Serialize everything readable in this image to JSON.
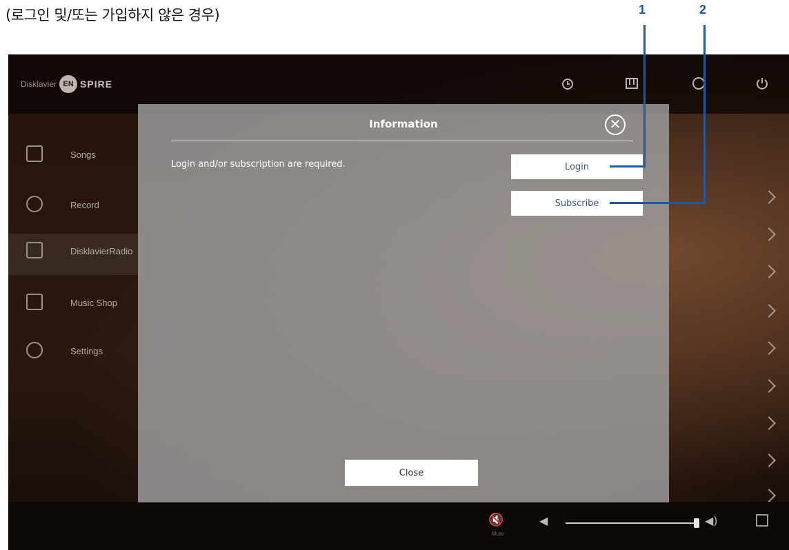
{
  "caption": "(로그인 및/또는 가입하지 않은 경우)",
  "callouts": [
    "1",
    "2"
  ],
  "app": {
    "logo": {
      "prefix": "Disklavier",
      "badge": "EN",
      "suffix": "SPIRE"
    },
    "top_icons": [
      "clock-icon",
      "piano-icon",
      "info-icon",
      "power-icon"
    ],
    "sidebar": [
      {
        "label": "Songs",
        "icon": "songs-icon"
      },
      {
        "label": "Record",
        "icon": "record-icon"
      },
      {
        "label": "DisklavierRadio",
        "icon": "radio-icon",
        "active": true
      },
      {
        "label": "Music Shop",
        "icon": "cart-icon"
      },
      {
        "label": "Settings",
        "icon": "gear-icon"
      }
    ],
    "bottom": {
      "mute_label": "Mute"
    }
  },
  "dialog": {
    "title": "Information",
    "close_x": "✕",
    "message": "Login and/or subscription are required.",
    "login_label": "Login",
    "subscribe_label": "Subscribe",
    "close_label": "Close"
  }
}
